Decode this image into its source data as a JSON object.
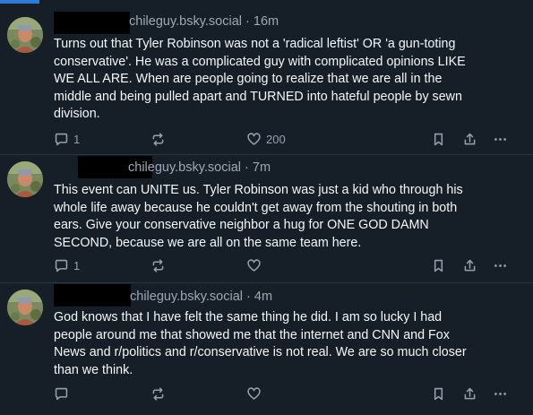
{
  "posts": [
    {
      "handle": "chileguy.bsky.social",
      "time": "16m",
      "text": "Turns out that Tyler Robinson was not a 'radical leftist' OR 'a gun-toting\nconservative'. He was a complicated guy with complicated opinions LIKE\nWE ALL ARE. When are people going to realize that we are all in the\nmiddle and being pulled apart and TURNED into hateful people by sewn\ndivision.",
      "replies": "1",
      "likes": "200"
    },
    {
      "handle": "chileguy.bsky.social",
      "time": "7m",
      "text": "This event can UNITE us. Tyler Robinson was just a kid who through his\nwhole life away because he couldn't get away from the shouting in both\nears. Give your conservative neighbor a hug for ONE GOD DAMN\nSECOND, because we are all on the same team here.",
      "replies": "1",
      "likes": ""
    },
    {
      "handle": "chileguy.bsky.social",
      "time": "4m",
      "text": "God knows that I have felt the same thing he did. I am so lucky I had\npeople around me that showed me that the internet and CNN and Fox\nNews and r/politics and r/conservative is not real. We are so much closer\nthan we think.",
      "replies": "",
      "likes": ""
    }
  ],
  "separator": "·",
  "icons": {
    "reply": "reply-icon",
    "repost": "repost-icon",
    "like": "heart-icon",
    "bookmark": "bookmark-icon",
    "share": "share-icon",
    "more": "more-icon"
  },
  "colors": {
    "background": "#161e27",
    "text": "#f5f7f9",
    "meta": "#9ea8b4",
    "icon": "#95a1ae",
    "divider": "#2a3645",
    "accent": "#2d7bd6"
  }
}
